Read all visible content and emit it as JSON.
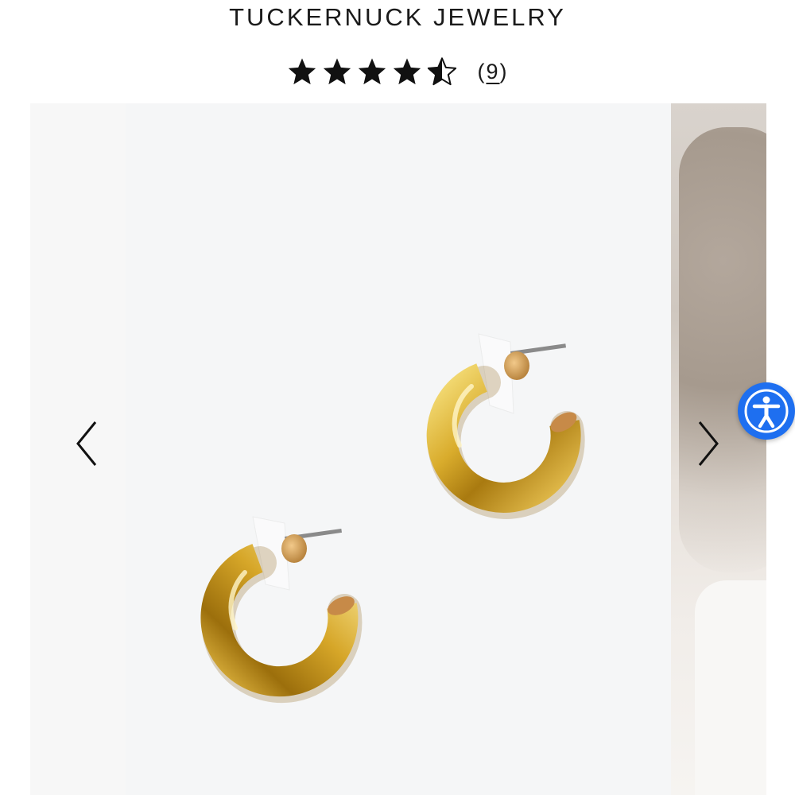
{
  "header": {
    "brand": "TUCKERNUCK JEWELRY"
  },
  "rating": {
    "stars": 4.5,
    "max_stars": 5,
    "open_paren": "(",
    "count": "9",
    "close_paren": ")"
  },
  "gallery": {
    "prev_icon": "chevron-left-icon",
    "next_icon": "chevron-right-icon",
    "main_image": "gold hoop earrings product photo"
  },
  "accessibility": {
    "icon": "accessibility-icon",
    "color": "#1e6ff0"
  },
  "colors": {
    "gold": "#c9a33a",
    "text": "#1a1a1a"
  }
}
